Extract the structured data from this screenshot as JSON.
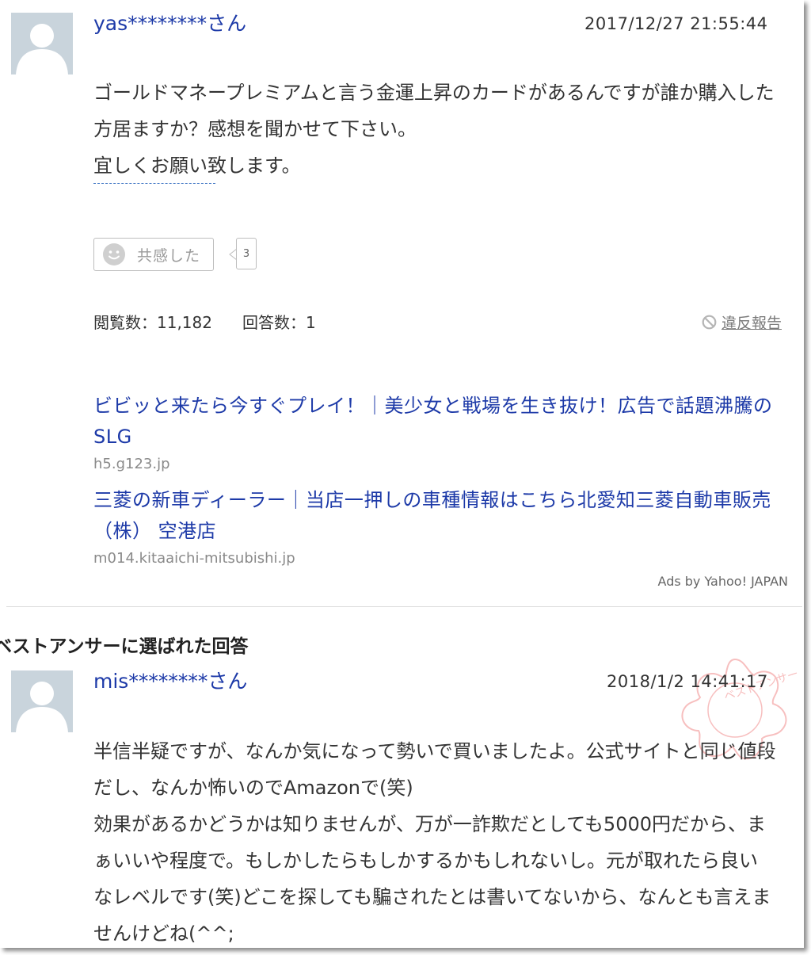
{
  "question": {
    "username": "yas********さん",
    "timestamp": "2017/12/27  21:55:44",
    "body": [
      "ゴールドマネープレミアムと言う金運上昇のカードがあるんですが誰か購入した方居ますか？感想を聞かせて下さい。",
      "宜しくお願い致します。"
    ],
    "empathy_label": "共感した",
    "empathy_count": "3",
    "views": "閲覧数：11,182",
    "answers": "回答数：1",
    "report_label": "違反報告"
  },
  "ads": {
    "items": [
      {
        "title": "ビビッと来たら今すぐプレイ！｜美少女と戦場を生き抜け！広告で話題沸騰のSLG",
        "url": "h5.g123.jp"
      },
      {
        "title": "三菱の新車ディーラー｜当店一押しの車種情報はこちら北愛知三菱自動車販売（株） 空港店",
        "url": "m014.kitaaichi-mitsubishi.jp"
      }
    ],
    "attribution": "Ads by Yahoo! JAPAN"
  },
  "best_answer": {
    "heading": "ベストアンサーに選ばれた回答",
    "username": "mis********さん",
    "timestamp": "2018/1/2  14:41:17",
    "body": [
      "半信半疑ですが、なんか気になって勢いで買いましたよ。公式サイトと同じ値段だし、なんか怖いのでAmazonで(笑)",
      "効果があるかどうかは知りませんが、万が一詐欺だとしても5000円だから、まぁいいや程度で。もしかしたらもしかするかもしれないし。元が取れたら良いなレベルです(笑)どこを探しても騙されたとは書いてないから、なんとも言えませんけどね(^^;"
    ],
    "stamp_text": "ベストアンサー"
  },
  "colors": {
    "link": "#1d3aa8",
    "stamp": "#f08080",
    "avatar_bg": "#c9d4dc"
  }
}
